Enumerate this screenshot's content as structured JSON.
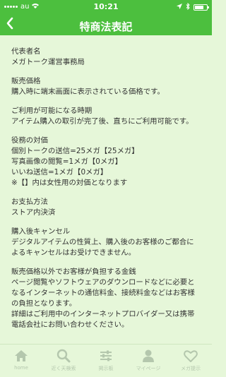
{
  "status_bar": {
    "carrier": "au",
    "time": "10:21"
  },
  "header": {
    "back_label": "<",
    "title": "特商法表記"
  },
  "sections": [
    {
      "lines": [
        "代表者名",
        "メガトーク運営事務局"
      ]
    },
    {
      "lines": [
        "販売価格",
        "購入時に端末画面に表示されている価格です。"
      ]
    },
    {
      "lines": [
        "ご利用が可能になる時期",
        "アイテム購入の取引が完了後、直ちにご利用可能です。"
      ]
    },
    {
      "lines": [
        "役務の対価",
        "個別トークの送信=25メガ【25メガ】",
        "写真画像の閲覧=1メガ【0メガ】",
        "いいね送信=1メガ【0メガ】",
        "※【】内は女性用の対価となります"
      ]
    },
    {
      "lines": [
        "お支払方法",
        "ストア内決済"
      ]
    },
    {
      "lines": [
        "購入後キャンセル",
        "デジタルアイテムの性質上、購入後のお客様のご都合に",
        "よるキャンセルはお受けできません。"
      ]
    },
    {
      "lines": [
        "販売価格以外でお客様が負担する金銭",
        "ページ閲覧やソフトウェアのダウンロードなどに必要と",
        "なるインターネットの通信料金、接続料金などはお客様",
        "の負担となります。",
        "詳細はご利用中のインターネットプロバイダー又は携帯",
        "電話会社にお問い合わせください。"
      ]
    }
  ],
  "tab_bar": {
    "items": [
      {
        "label": "home",
        "icon": "home-icon"
      },
      {
        "label": "近く天検索",
        "icon": "search-icon"
      },
      {
        "label": "掲示板",
        "icon": "sliders-icon"
      },
      {
        "label": "マイページ",
        "icon": "person-icon"
      },
      {
        "label": "メガ提示",
        "icon": "heart-icon"
      }
    ]
  },
  "colors": {
    "accent": "#4cbf3e",
    "background": "#e6f7d9",
    "text": "#333333",
    "tab_inactive": "#b4c7ad"
  }
}
